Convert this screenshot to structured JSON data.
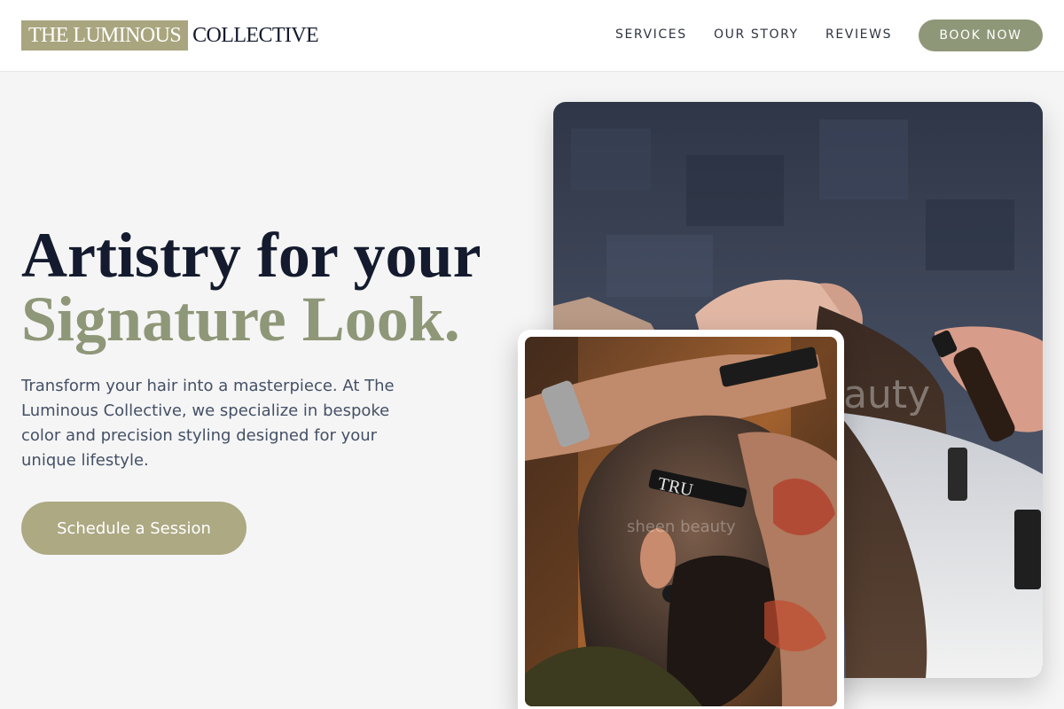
{
  "header": {
    "logo_highlight": "THE LUMINOUS",
    "logo_rest": "COLLECTIVE",
    "nav": [
      {
        "label": "SERVICES"
      },
      {
        "label": "OUR STORY"
      },
      {
        "label": "REVIEWS"
      }
    ],
    "book_label": "BOOK NOW"
  },
  "hero": {
    "headline_line1": "Artistry for your",
    "headline_line2": "Signature Look.",
    "description": "Transform your hair into a masterpiece. At The Luminous Collective, we specialize in bespoke color and precision styling designed for your unique lifestyle.",
    "cta_label": "Schedule a Session"
  },
  "images": {
    "large_photo": {
      "subject": "hair-wash-photo",
      "watermark": "eauty"
    },
    "small_photo": {
      "subject": "barber-shave-photo",
      "razor_text": "TRU",
      "watermark": "sheen beauty"
    }
  },
  "colors": {
    "accent_sage": "#8e9778",
    "accent_khaki": "#a9a57f",
    "navy": "#141b2e"
  }
}
